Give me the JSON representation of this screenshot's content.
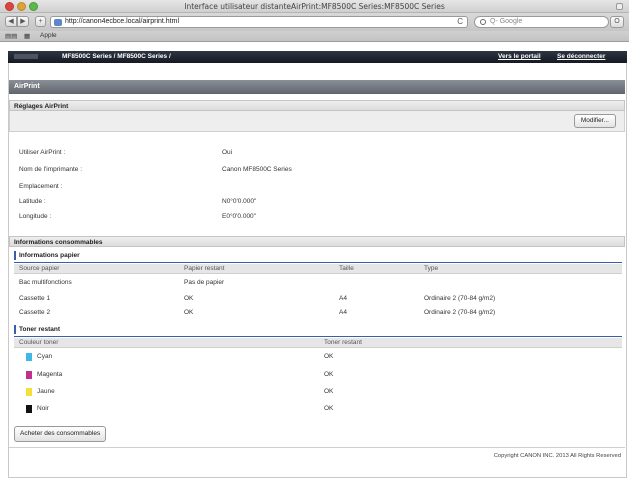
{
  "window": {
    "title": "Interface utilisateur distanteAirPrint:MF8500C Series:MF8500C Series"
  },
  "browser": {
    "url": "http://canon4ecbce.local/airprint.html",
    "search_placeholder": "Q- Google",
    "back_glyph": "◀",
    "forward_glyph": "▶",
    "add_glyph": "+",
    "reload_glyph": "C",
    "action_glyph": "O",
    "bookmarks": [
      {
        "label": "Apple"
      }
    ]
  },
  "topnav": {
    "breadcrumb": "MF8500C Series / MF8500C Series /",
    "portal_link": "Vers le portail",
    "logout_link": "Se déconnecter"
  },
  "section": {
    "title": "AirPrint"
  },
  "settings": {
    "title": "Réglages AirPrint",
    "modify_button": "Modifier...",
    "rows": [
      {
        "label": "Utiliser AirPrint :",
        "value": "Oui"
      },
      {
        "label": "Nom de l'imprimante :",
        "value": "Canon MF8500C Series"
      },
      {
        "label": "Emplacement :",
        "value": ""
      },
      {
        "label": "Latitude :",
        "value": "N0°0'0.000\""
      },
      {
        "label": "Longitude :",
        "value": "E0°0'0.000\""
      }
    ]
  },
  "consumables": {
    "title": "Informations consommables",
    "paper": {
      "title": "Informations papier",
      "headers": [
        "Source papier",
        "Papier restant",
        "Taille",
        "Type"
      ],
      "rows": [
        [
          "Bac multifonctions",
          "Pas de papier",
          "",
          ""
        ],
        [
          "Cassette 1",
          "OK",
          "A4",
          "Ordinaire 2 (70-84 g/m2)"
        ],
        [
          "Cassette 2",
          "OK",
          "A4",
          "Ordinaire 2 (70-84 g/m2)"
        ]
      ]
    },
    "toner": {
      "title": "Toner restant",
      "headers": [
        "Couleur toner",
        "Toner restant"
      ],
      "rows": [
        {
          "color_name": "Cyan",
          "swatch": "#3fb7e8",
          "status": "OK"
        },
        {
          "color_name": "Magenta",
          "swatch": "#c0308c",
          "status": "OK"
        },
        {
          "color_name": "Jaune",
          "swatch": "#f4e03a",
          "status": "OK"
        },
        {
          "color_name": "Noir",
          "swatch": "#111111",
          "status": "OK"
        }
      ]
    },
    "buy_button": "Acheter des consommables"
  },
  "footer": {
    "copyright": "Copyright CANON INC. 2013 All Rights Reserved"
  }
}
